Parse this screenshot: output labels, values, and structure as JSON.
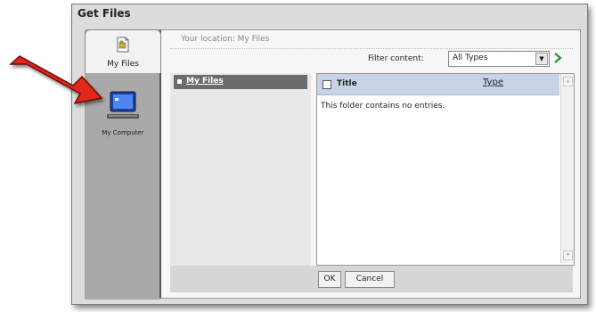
{
  "dialog": {
    "title": "Get Files"
  },
  "sidebar": {
    "tab": {
      "label": "My Files",
      "icon": "file-icon"
    },
    "items": [
      {
        "label": "My Computer",
        "icon": "computer-icon"
      }
    ]
  },
  "location": {
    "text": "Your location: My Files"
  },
  "filter": {
    "label": "Filter content:",
    "selected": "All Types",
    "go_icon": "go-arrow-icon"
  },
  "tree": {
    "items": [
      {
        "label": "My Files"
      }
    ]
  },
  "list": {
    "columns": [
      "Title",
      "Type"
    ],
    "empty_message": "This folder contains no entries."
  },
  "buttons": {
    "ok": "OK",
    "cancel": "Cancel"
  },
  "colors": {
    "arrow": "#e3261b",
    "header_bg": "#c7d3e6",
    "tree_selected_bg": "#6c6c6c",
    "go_arrow": "#2e9a2e"
  }
}
